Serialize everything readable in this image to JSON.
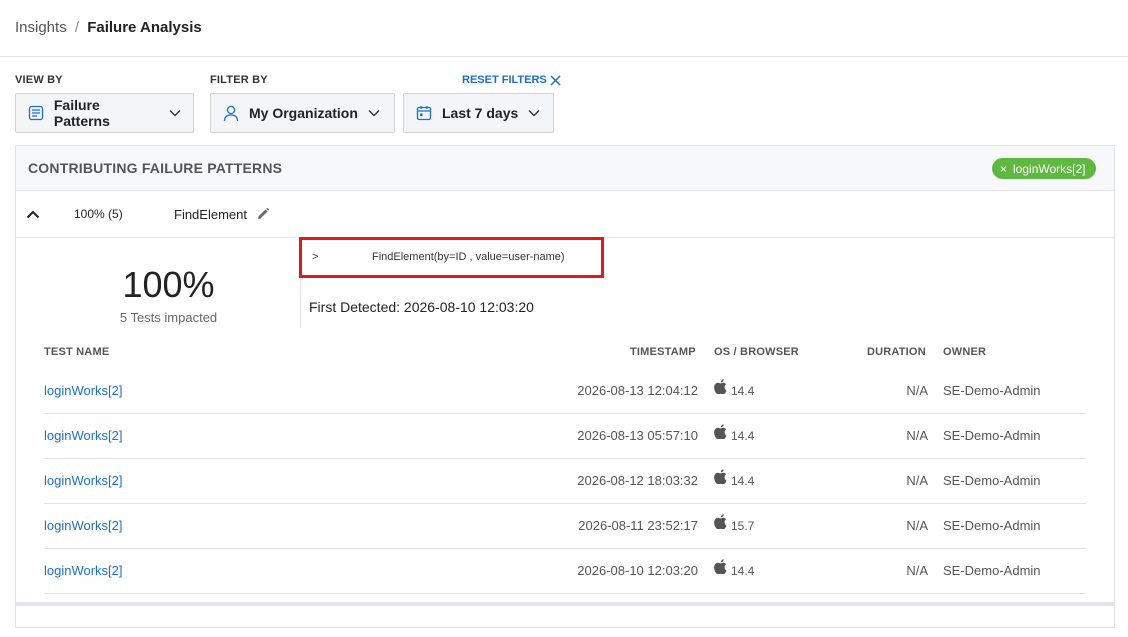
{
  "breadcrumb": {
    "parent": "Insights",
    "separator": "/",
    "current": "Failure Analysis"
  },
  "filters": {
    "view_by_label": "VIEW BY",
    "filter_by_label": "FILTER BY",
    "reset_label": "RESET FILTERS",
    "view_by_value": "Failure Patterns",
    "organization_value": "My Organization",
    "date_range_value": "Last 7 days"
  },
  "panel": {
    "title": "CONTRIBUTING FAILURE PATTERNS",
    "chip_label": "loginWorks[2]",
    "chip_remove": "×"
  },
  "pattern": {
    "percent_count": "100% (5)",
    "name": "FindElement",
    "big_percent": "100%",
    "impacted": "5 Tests impacted",
    "stack_prefix": ">",
    "stack_text": "FindElement(by=ID , value=user-name)",
    "first_detected": "First Detected: 2026-08-10 12:03:20"
  },
  "table": {
    "headers": {
      "name": "TEST NAME",
      "timestamp": "TIMESTAMP",
      "os": "OS / BROWSER",
      "duration": "DURATION",
      "owner": "OWNER"
    },
    "rows": [
      {
        "name": "loginWorks[2]",
        "timestamp": "2026-08-13 12:04:12",
        "os_icon": "apple-icon",
        "os_version": "14.4",
        "duration": "N/A",
        "owner": "SE-Demo-Admin"
      },
      {
        "name": "loginWorks[2]",
        "timestamp": "2026-08-13 05:57:10",
        "os_icon": "apple-icon",
        "os_version": "14.4",
        "duration": "N/A",
        "owner": "SE-Demo-Admin"
      },
      {
        "name": "loginWorks[2]",
        "timestamp": "2026-08-12 18:03:32",
        "os_icon": "apple-icon",
        "os_version": "14.4",
        "duration": "N/A",
        "owner": "SE-Demo-Admin"
      },
      {
        "name": "loginWorks[2]",
        "timestamp": "2026-08-11 23:52:17",
        "os_icon": "apple-icon",
        "os_version": "15.7",
        "duration": "N/A",
        "owner": "SE-Demo-Admin"
      },
      {
        "name": "loginWorks[2]",
        "timestamp": "2026-08-10 12:03:20",
        "os_icon": "apple-icon",
        "os_version": "14.4",
        "duration": "N/A",
        "owner": "SE-Demo-Admin"
      }
    ]
  },
  "colors": {
    "link": "#1a6fd1",
    "chip": "#5fb83f",
    "highlight": "#e0191d"
  }
}
